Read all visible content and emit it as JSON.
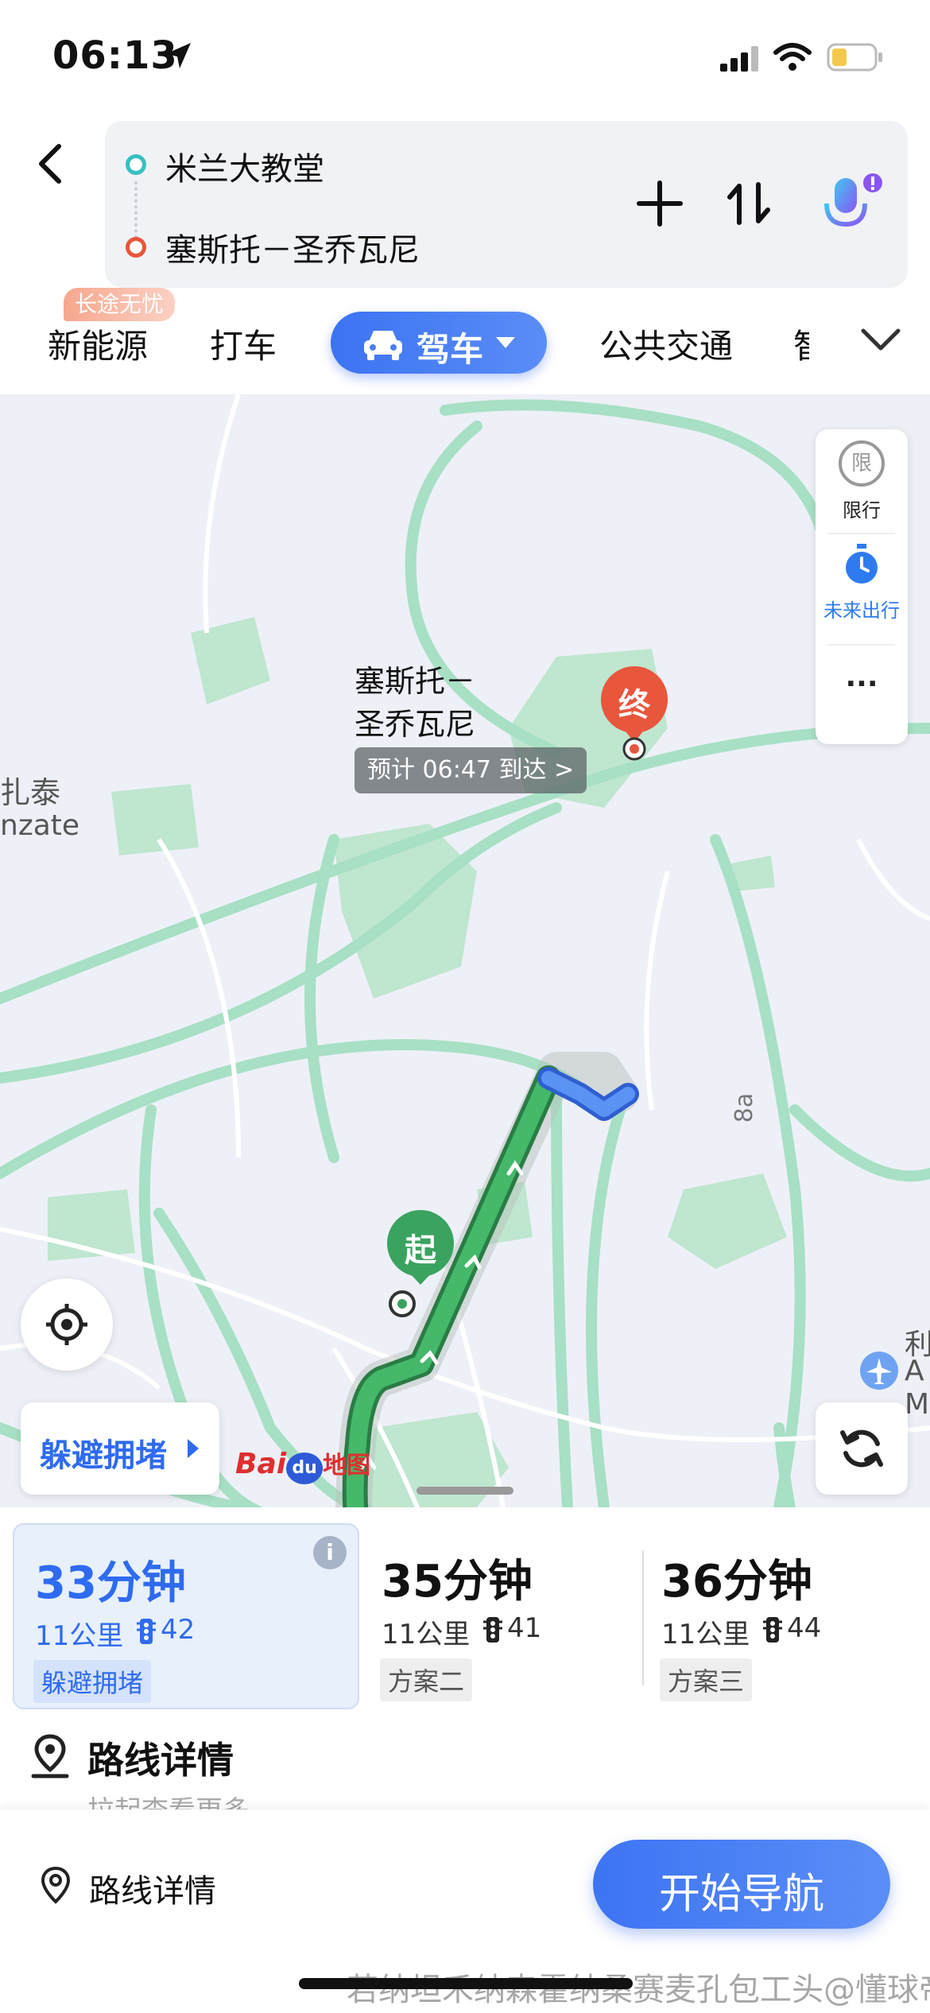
{
  "status_bar": {
    "time": "06:13"
  },
  "route": {
    "origin": "米兰大教堂",
    "destination": "塞斯托－圣乔瓦尼"
  },
  "modes": {
    "badge": "长途无忧",
    "items": [
      "新能源",
      "打车",
      "驾车",
      "公共交通",
      "智"
    ],
    "selected": "驾车"
  },
  "map": {
    "destination_label_line1": "塞斯托－",
    "destination_label_line2": "圣乔瓦尼",
    "eta_bubble": "预计 06:47 到达 >",
    "start_marker": "起",
    "end_marker": "终",
    "place_label_left1": "扎泰",
    "place_label_left2": "nzate",
    "road_label": "8a",
    "right_edge_label1": "利",
    "right_edge_label2": "A",
    "right_edge_label3": "M",
    "side_panel": {
      "restrict_icon": "限",
      "restrict_label": "限行",
      "future_label": "未来出行",
      "more": "···"
    },
    "avoid_button": "躲避拥堵",
    "logo_text_bai": "Bai",
    "logo_text_du": "du",
    "logo_text_map": "地图"
  },
  "options": [
    {
      "time": "33分钟",
      "distance": "11公里",
      "lights": "42",
      "tag": "躲避拥堵",
      "info_icon": "i"
    },
    {
      "time": "35分钟",
      "distance": "11公里",
      "lights": "41",
      "tag": "方案二"
    },
    {
      "time": "36分钟",
      "distance": "11公里",
      "lights": "44",
      "tag": "方案三"
    }
  ],
  "details": {
    "title": "路线详情",
    "subtitle": "拉起查看更多"
  },
  "bottom": {
    "details_label": "路线详情",
    "start_nav": "开始导航"
  },
  "watermark": "若纳坦禾纳森霍纳桑赛麦孔包工头@懂球帝",
  "colors": {
    "accent": "#3c73f2",
    "route_green": "#3aa35f",
    "destination_red": "#e8563c",
    "park_green": "#b9e3cb"
  }
}
